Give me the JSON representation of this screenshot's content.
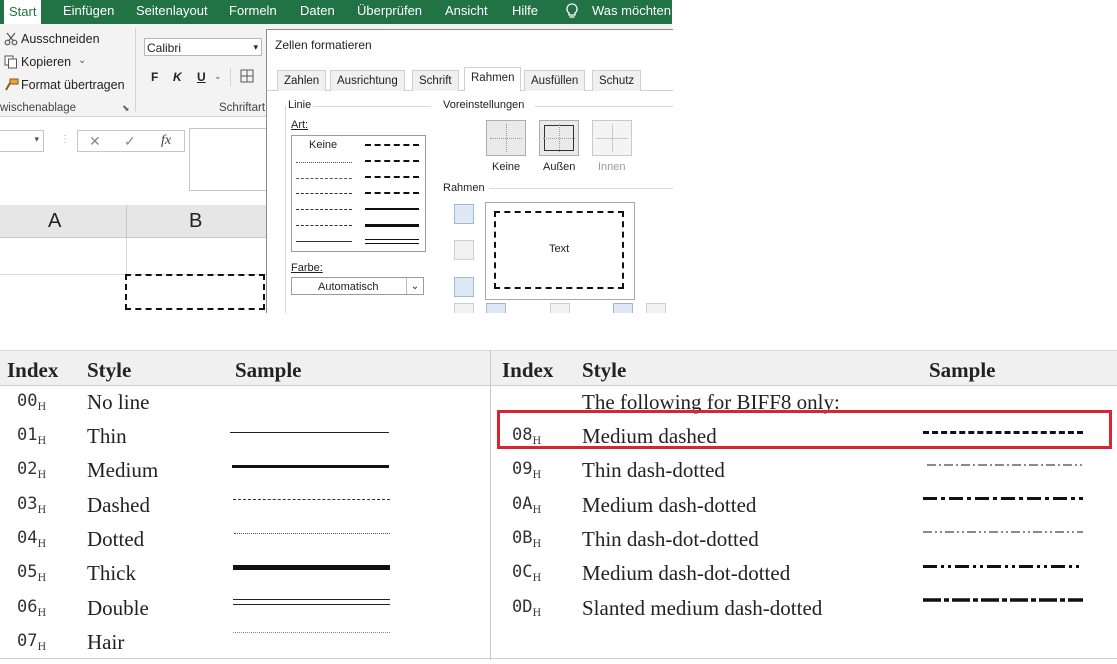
{
  "ribbon": {
    "tabs": [
      "Start",
      "Einfügen",
      "Seitenlayout",
      "Formeln",
      "Daten",
      "Überprüfen",
      "Ansicht",
      "Hilfe",
      "Was möchten S"
    ],
    "clipboard": {
      "cut": "Ausschneiden",
      "copy": "Kopieren",
      "format_painter": "Format übertragen",
      "group_label": "wischenablage"
    },
    "font": {
      "name": "Calibri",
      "bold": "F",
      "italic": "K",
      "underline": "U",
      "group_label": "Schriftart"
    },
    "formula_cancel": "✕",
    "formula_enter": "✓",
    "formula_fx": "fx"
  },
  "grid": {
    "columns": [
      "A",
      "B"
    ]
  },
  "dialog": {
    "title": "Zellen formatieren",
    "tabs": [
      "Zahlen",
      "Ausrichtung",
      "Schrift",
      "Rahmen",
      "Ausfüllen",
      "Schutz"
    ],
    "active_tab": "Rahmen",
    "line_group": "Linie",
    "style_label": "Art:",
    "none_label": "Keine",
    "color_label": "Farbe:",
    "color_value": "Automatisch",
    "presets_group": "Voreinstellungen",
    "presets": [
      "Keine",
      "Außen",
      "Innen"
    ],
    "border_group": "Rahmen",
    "preview_text": "Text"
  },
  "table": {
    "headers": {
      "index": "Index",
      "style": "Style",
      "sample": "Sample"
    },
    "left": [
      {
        "index": "00",
        "style": "No line",
        "sample": "none"
      },
      {
        "index": "01",
        "style": "Thin",
        "sample": "thin"
      },
      {
        "index": "02",
        "style": "Medium",
        "sample": "medium"
      },
      {
        "index": "03",
        "style": "Dashed",
        "sample": "dashed"
      },
      {
        "index": "04",
        "style": "Dotted",
        "sample": "dotted"
      },
      {
        "index": "05",
        "style": "Thick",
        "sample": "thick"
      },
      {
        "index": "06",
        "style": "Double",
        "sample": "double"
      },
      {
        "index": "07",
        "style": "Hair",
        "sample": "hair"
      }
    ],
    "right_note": "The following for BIFF8 only:",
    "right": [
      {
        "index": "08",
        "style": "Medium dashed",
        "sample": "medium-dashed",
        "highlighted": true
      },
      {
        "index": "09",
        "style": "Thin dash-dotted",
        "sample": "thin-dash-dotted"
      },
      {
        "index": "0A",
        "style": "Medium dash-dotted",
        "sample": "medium-dash-dotted"
      },
      {
        "index": "0B",
        "style": "Thin dash-dot-dotted",
        "sample": "thin-dash-dot-dotted"
      },
      {
        "index": "0C",
        "style": "Medium dash-dot-dotted",
        "sample": "medium-dash-dot-dotted"
      },
      {
        "index": "0D",
        "style": "Slanted medium dash-dotted",
        "sample": "slanted-medium-dash-dotted"
      }
    ],
    "hex_suffix": "H",
    "highlight_color": "#d7262f"
  }
}
